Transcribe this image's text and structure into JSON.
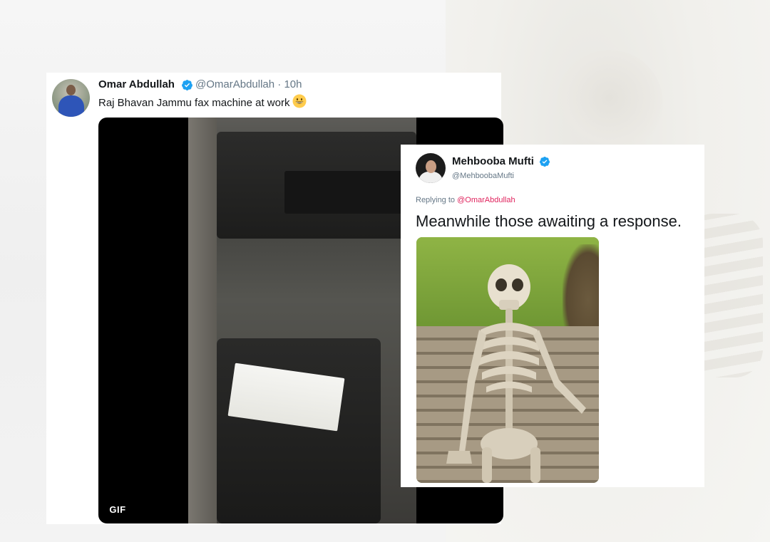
{
  "tweet_omar": {
    "name": "Omar Abdullah",
    "handle_time": "@OmarAbdullah · 10h",
    "text": "Raj Bhavan Jammu fax machine at work",
    "media_badge": "GIF"
  },
  "tweet_mehbooba": {
    "name": "Mehbooba Mufti",
    "handle": "@MehboobaMufti",
    "replying_to_prefix": "Replying to ",
    "replying_to_mention": "@OmarAbdullah",
    "text": "Meanwhile those awaiting a response."
  },
  "colors": {
    "verified_badge": "#1da1f2",
    "mention": "#e0245e",
    "secondary_text": "#657786"
  },
  "icons": {
    "verified": "verified-badge-icon",
    "emoji": "grinning-face-emoji"
  }
}
